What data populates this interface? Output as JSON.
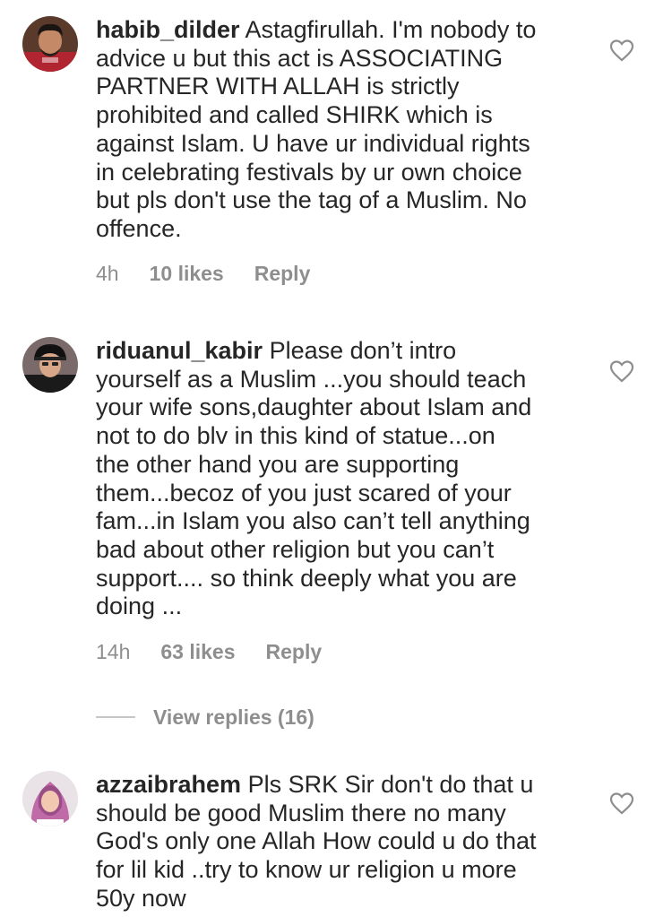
{
  "comments": [
    {
      "username": "habib_dilder",
      "text": "Astagfirullah. I'm nobody to\nadvice u but this act is ASSOCIATING\nPARTNER WITH ALLAH is strictly\nprohibited and called SHIRK which is\nagainst Islam.  U have ur individual rights\nin celebrating festivals by ur own choice\nbut pls don't use the tag of a Muslim. No\noffence.",
      "time": "4h",
      "likes": "10 likes",
      "reply": "Reply",
      "avatar_icon": "man-avatar-icon"
    },
    {
      "username": "riduanul_kabir",
      "text": "Please don’t intro\nyourself as a Muslim ...you should teach\nyour wife sons,daughter about Islam and\nnot to do blv in this kind of statue...on\nthe other hand you are supporting\nthem...becoz of you just scared of your\nfam...in Islam you also can’t tell anything\nbad about other religion but you can’t\nsupport.... so think deeply what you are\ndoing ...",
      "time": "14h",
      "likes": "63 likes",
      "reply": "Reply",
      "avatar_icon": "man-in-cap-avatar-icon"
    },
    {
      "username": "azzaibrahem",
      "text": "Pls SRK Sir don't do that u\nshould be good Muslim there no many\nGod's only one Allah How could u do that\nfor lil kid ..try to know ur religion  u more\n50y now",
      "avatar_icon": "woman-hijab-avatar-icon"
    }
  ],
  "view_replies": "View replies (16)",
  "colors": {
    "text": "#262626",
    "secondary": "#8e8e8e",
    "divider": "#c7c7c7"
  }
}
